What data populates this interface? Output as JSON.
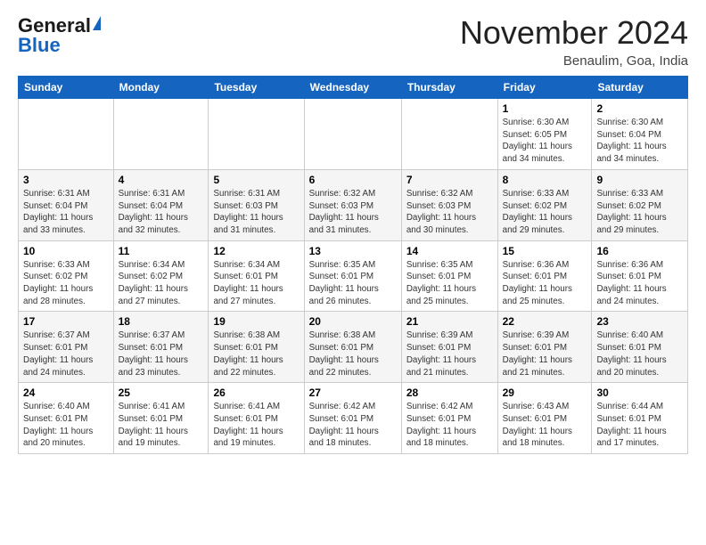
{
  "logo": {
    "general": "General",
    "blue": "Blue"
  },
  "header": {
    "month": "November 2024",
    "location": "Benaulim, Goa, India"
  },
  "weekdays": [
    "Sunday",
    "Monday",
    "Tuesday",
    "Wednesday",
    "Thursday",
    "Friday",
    "Saturday"
  ],
  "weeks": [
    [
      {
        "day": "",
        "info": ""
      },
      {
        "day": "",
        "info": ""
      },
      {
        "day": "",
        "info": ""
      },
      {
        "day": "",
        "info": ""
      },
      {
        "day": "",
        "info": ""
      },
      {
        "day": "1",
        "info": "Sunrise: 6:30 AM\nSunset: 6:05 PM\nDaylight: 11 hours\nand 34 minutes."
      },
      {
        "day": "2",
        "info": "Sunrise: 6:30 AM\nSunset: 6:04 PM\nDaylight: 11 hours\nand 34 minutes."
      }
    ],
    [
      {
        "day": "3",
        "info": "Sunrise: 6:31 AM\nSunset: 6:04 PM\nDaylight: 11 hours\nand 33 minutes."
      },
      {
        "day": "4",
        "info": "Sunrise: 6:31 AM\nSunset: 6:04 PM\nDaylight: 11 hours\nand 32 minutes."
      },
      {
        "day": "5",
        "info": "Sunrise: 6:31 AM\nSunset: 6:03 PM\nDaylight: 11 hours\nand 31 minutes."
      },
      {
        "day": "6",
        "info": "Sunrise: 6:32 AM\nSunset: 6:03 PM\nDaylight: 11 hours\nand 31 minutes."
      },
      {
        "day": "7",
        "info": "Sunrise: 6:32 AM\nSunset: 6:03 PM\nDaylight: 11 hours\nand 30 minutes."
      },
      {
        "day": "8",
        "info": "Sunrise: 6:33 AM\nSunset: 6:02 PM\nDaylight: 11 hours\nand 29 minutes."
      },
      {
        "day": "9",
        "info": "Sunrise: 6:33 AM\nSunset: 6:02 PM\nDaylight: 11 hours\nand 29 minutes."
      }
    ],
    [
      {
        "day": "10",
        "info": "Sunrise: 6:33 AM\nSunset: 6:02 PM\nDaylight: 11 hours\nand 28 minutes."
      },
      {
        "day": "11",
        "info": "Sunrise: 6:34 AM\nSunset: 6:02 PM\nDaylight: 11 hours\nand 27 minutes."
      },
      {
        "day": "12",
        "info": "Sunrise: 6:34 AM\nSunset: 6:01 PM\nDaylight: 11 hours\nand 27 minutes."
      },
      {
        "day": "13",
        "info": "Sunrise: 6:35 AM\nSunset: 6:01 PM\nDaylight: 11 hours\nand 26 minutes."
      },
      {
        "day": "14",
        "info": "Sunrise: 6:35 AM\nSunset: 6:01 PM\nDaylight: 11 hours\nand 25 minutes."
      },
      {
        "day": "15",
        "info": "Sunrise: 6:36 AM\nSunset: 6:01 PM\nDaylight: 11 hours\nand 25 minutes."
      },
      {
        "day": "16",
        "info": "Sunrise: 6:36 AM\nSunset: 6:01 PM\nDaylight: 11 hours\nand 24 minutes."
      }
    ],
    [
      {
        "day": "17",
        "info": "Sunrise: 6:37 AM\nSunset: 6:01 PM\nDaylight: 11 hours\nand 24 minutes."
      },
      {
        "day": "18",
        "info": "Sunrise: 6:37 AM\nSunset: 6:01 PM\nDaylight: 11 hours\nand 23 minutes."
      },
      {
        "day": "19",
        "info": "Sunrise: 6:38 AM\nSunset: 6:01 PM\nDaylight: 11 hours\nand 22 minutes."
      },
      {
        "day": "20",
        "info": "Sunrise: 6:38 AM\nSunset: 6:01 PM\nDaylight: 11 hours\nand 22 minutes."
      },
      {
        "day": "21",
        "info": "Sunrise: 6:39 AM\nSunset: 6:01 PM\nDaylight: 11 hours\nand 21 minutes."
      },
      {
        "day": "22",
        "info": "Sunrise: 6:39 AM\nSunset: 6:01 PM\nDaylight: 11 hours\nand 21 minutes."
      },
      {
        "day": "23",
        "info": "Sunrise: 6:40 AM\nSunset: 6:01 PM\nDaylight: 11 hours\nand 20 minutes."
      }
    ],
    [
      {
        "day": "24",
        "info": "Sunrise: 6:40 AM\nSunset: 6:01 PM\nDaylight: 11 hours\nand 20 minutes."
      },
      {
        "day": "25",
        "info": "Sunrise: 6:41 AM\nSunset: 6:01 PM\nDaylight: 11 hours\nand 19 minutes."
      },
      {
        "day": "26",
        "info": "Sunrise: 6:41 AM\nSunset: 6:01 PM\nDaylight: 11 hours\nand 19 minutes."
      },
      {
        "day": "27",
        "info": "Sunrise: 6:42 AM\nSunset: 6:01 PM\nDaylight: 11 hours\nand 18 minutes."
      },
      {
        "day": "28",
        "info": "Sunrise: 6:42 AM\nSunset: 6:01 PM\nDaylight: 11 hours\nand 18 minutes."
      },
      {
        "day": "29",
        "info": "Sunrise: 6:43 AM\nSunset: 6:01 PM\nDaylight: 11 hours\nand 18 minutes."
      },
      {
        "day": "30",
        "info": "Sunrise: 6:44 AM\nSunset: 6:01 PM\nDaylight: 11 hours\nand 17 minutes."
      }
    ]
  ]
}
